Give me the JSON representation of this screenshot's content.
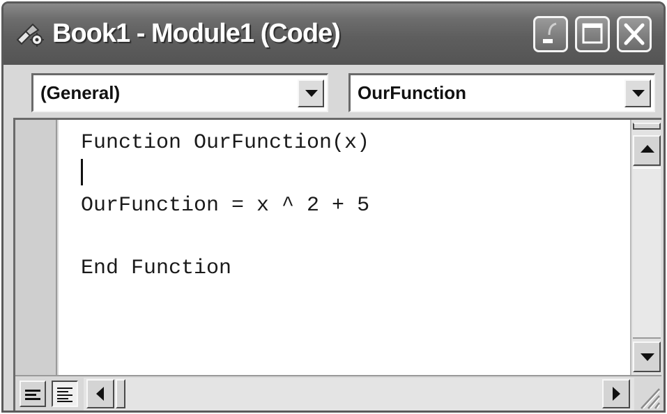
{
  "window": {
    "title": "Book1 - Module1 (Code)",
    "icon": "vba-module-icon"
  },
  "titlebar_buttons": {
    "minimize": "minimize-icon",
    "maximize": "maximize-icon",
    "close": "close-icon"
  },
  "object_combo": {
    "selected": "(General)"
  },
  "procedure_combo": {
    "selected": "OurFunction"
  },
  "code": {
    "lines": [
      "Function OurFunction(x)",
      "",
      "OurFunction = x ^ 2 + 5",
      "",
      "End Function"
    ]
  },
  "colors": {
    "titlebar": "#5e5e5e",
    "title_text": "#ffffff",
    "editor_background": "#ffffff",
    "chrome": "#d8d8d8"
  }
}
